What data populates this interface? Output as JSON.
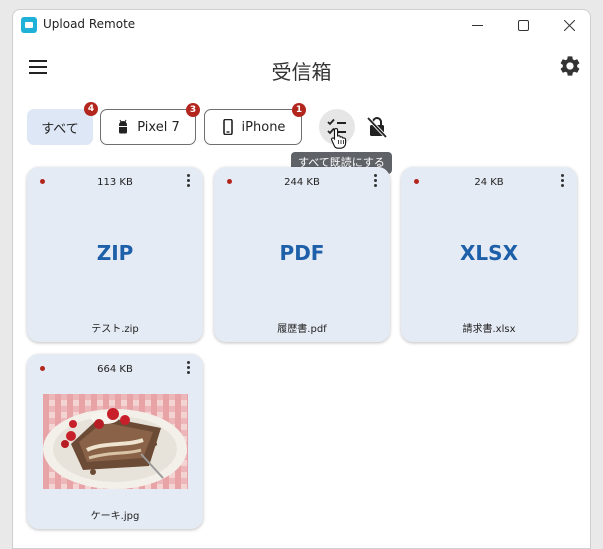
{
  "window": {
    "title": "Upload Remote"
  },
  "appbar": {
    "title": "受信箱"
  },
  "filters": [
    {
      "label": "すべて",
      "badge": "4"
    },
    {
      "label": "Pixel 7",
      "badge": "3"
    },
    {
      "label": "iPhone",
      "badge": "1"
    }
  ],
  "tooltip": {
    "text": "すべて既読にする"
  },
  "files": [
    {
      "size": "113 KB",
      "ext": "ZIP",
      "name": "テスト.zip"
    },
    {
      "size": "244 KB",
      "ext": "PDF",
      "name": "履歴書.pdf"
    },
    {
      "size": "24 KB",
      "ext": "XLSX",
      "name": "請求書.xlsx"
    },
    {
      "size": "664 KB",
      "ext": "",
      "name": "ケーキ.jpg"
    }
  ],
  "colors": {
    "accent": "#1d5fa8",
    "badge": "#b3261e",
    "card": "#e5ebf5",
    "chip_selected": "#dde7f6"
  }
}
